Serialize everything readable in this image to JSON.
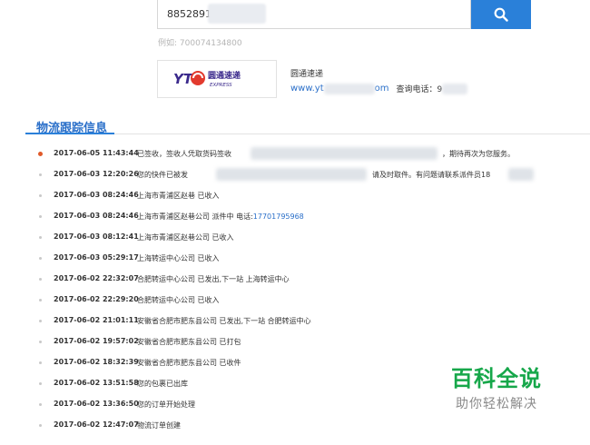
{
  "search": {
    "value": "8852891",
    "button_icon": "search-icon",
    "example": "例如: 700074134800"
  },
  "carrier": {
    "logo_text": "圆通速递",
    "logo_en": "EXPRESS",
    "logo_mark": "YT",
    "name": "圆通速递",
    "site_prefix": "www.yt",
    "site_suffix": "om",
    "phone_label": "查询电话：9",
    "brand_color": "#2a6fc9"
  },
  "section": {
    "title": "物流跟踪信息"
  },
  "timeline": [
    {
      "time": "2017-06-05 11:43:44",
      "desc_a": "已签收，签收人凭取货码签收",
      "desc_b": "，期待再次为您服务。"
    },
    {
      "time": "2017-06-03 12:20:26",
      "desc_a": "您的快件已被发",
      "desc_b": "请及时取件。有问题请联系派件员18"
    },
    {
      "time": "2017-06-03 08:24:46",
      "desc_a": "上海市青浦区赵巷 已收入"
    },
    {
      "time": "2017-06-03 08:24:46",
      "desc_a": "上海市青浦区赵巷公司 派件中 电话:",
      "phone": "17701795968"
    },
    {
      "time": "2017-06-03 08:12:41",
      "desc_a": "上海市青浦区赵巷公司 已收入"
    },
    {
      "time": "2017-06-03 05:29:17",
      "desc_a": "上海转运中心公司 已收入"
    },
    {
      "time": "2017-06-02 22:32:07",
      "desc_a": "合肥转运中心公司 已发出,下一站 上海转运中心"
    },
    {
      "time": "2017-06-02 22:29:20",
      "desc_a": "合肥转运中心公司 已收入"
    },
    {
      "time": "2017-06-02 21:01:11",
      "desc_a": "安徽省合肥市肥东县公司 已发出,下一站 合肥转运中心"
    },
    {
      "time": "2017-06-02 19:57:02",
      "desc_a": "安徽省合肥市肥东县公司 已打包"
    },
    {
      "time": "2017-06-02 18:32:39",
      "desc_a": "安徽省合肥市肥东县公司 已收件"
    },
    {
      "time": "2017-06-02 13:51:58",
      "desc_a": "您的包裹已出库"
    },
    {
      "time": "2017-06-02 13:36:50",
      "desc_a": "您的订单开始处理"
    },
    {
      "time": "2017-06-02 12:47:07",
      "desc_a": "物流订单创建"
    }
  ],
  "watermark": {
    "title": "百科全说",
    "subtitle": "助你轻松解决",
    "color": "#16a74a"
  }
}
